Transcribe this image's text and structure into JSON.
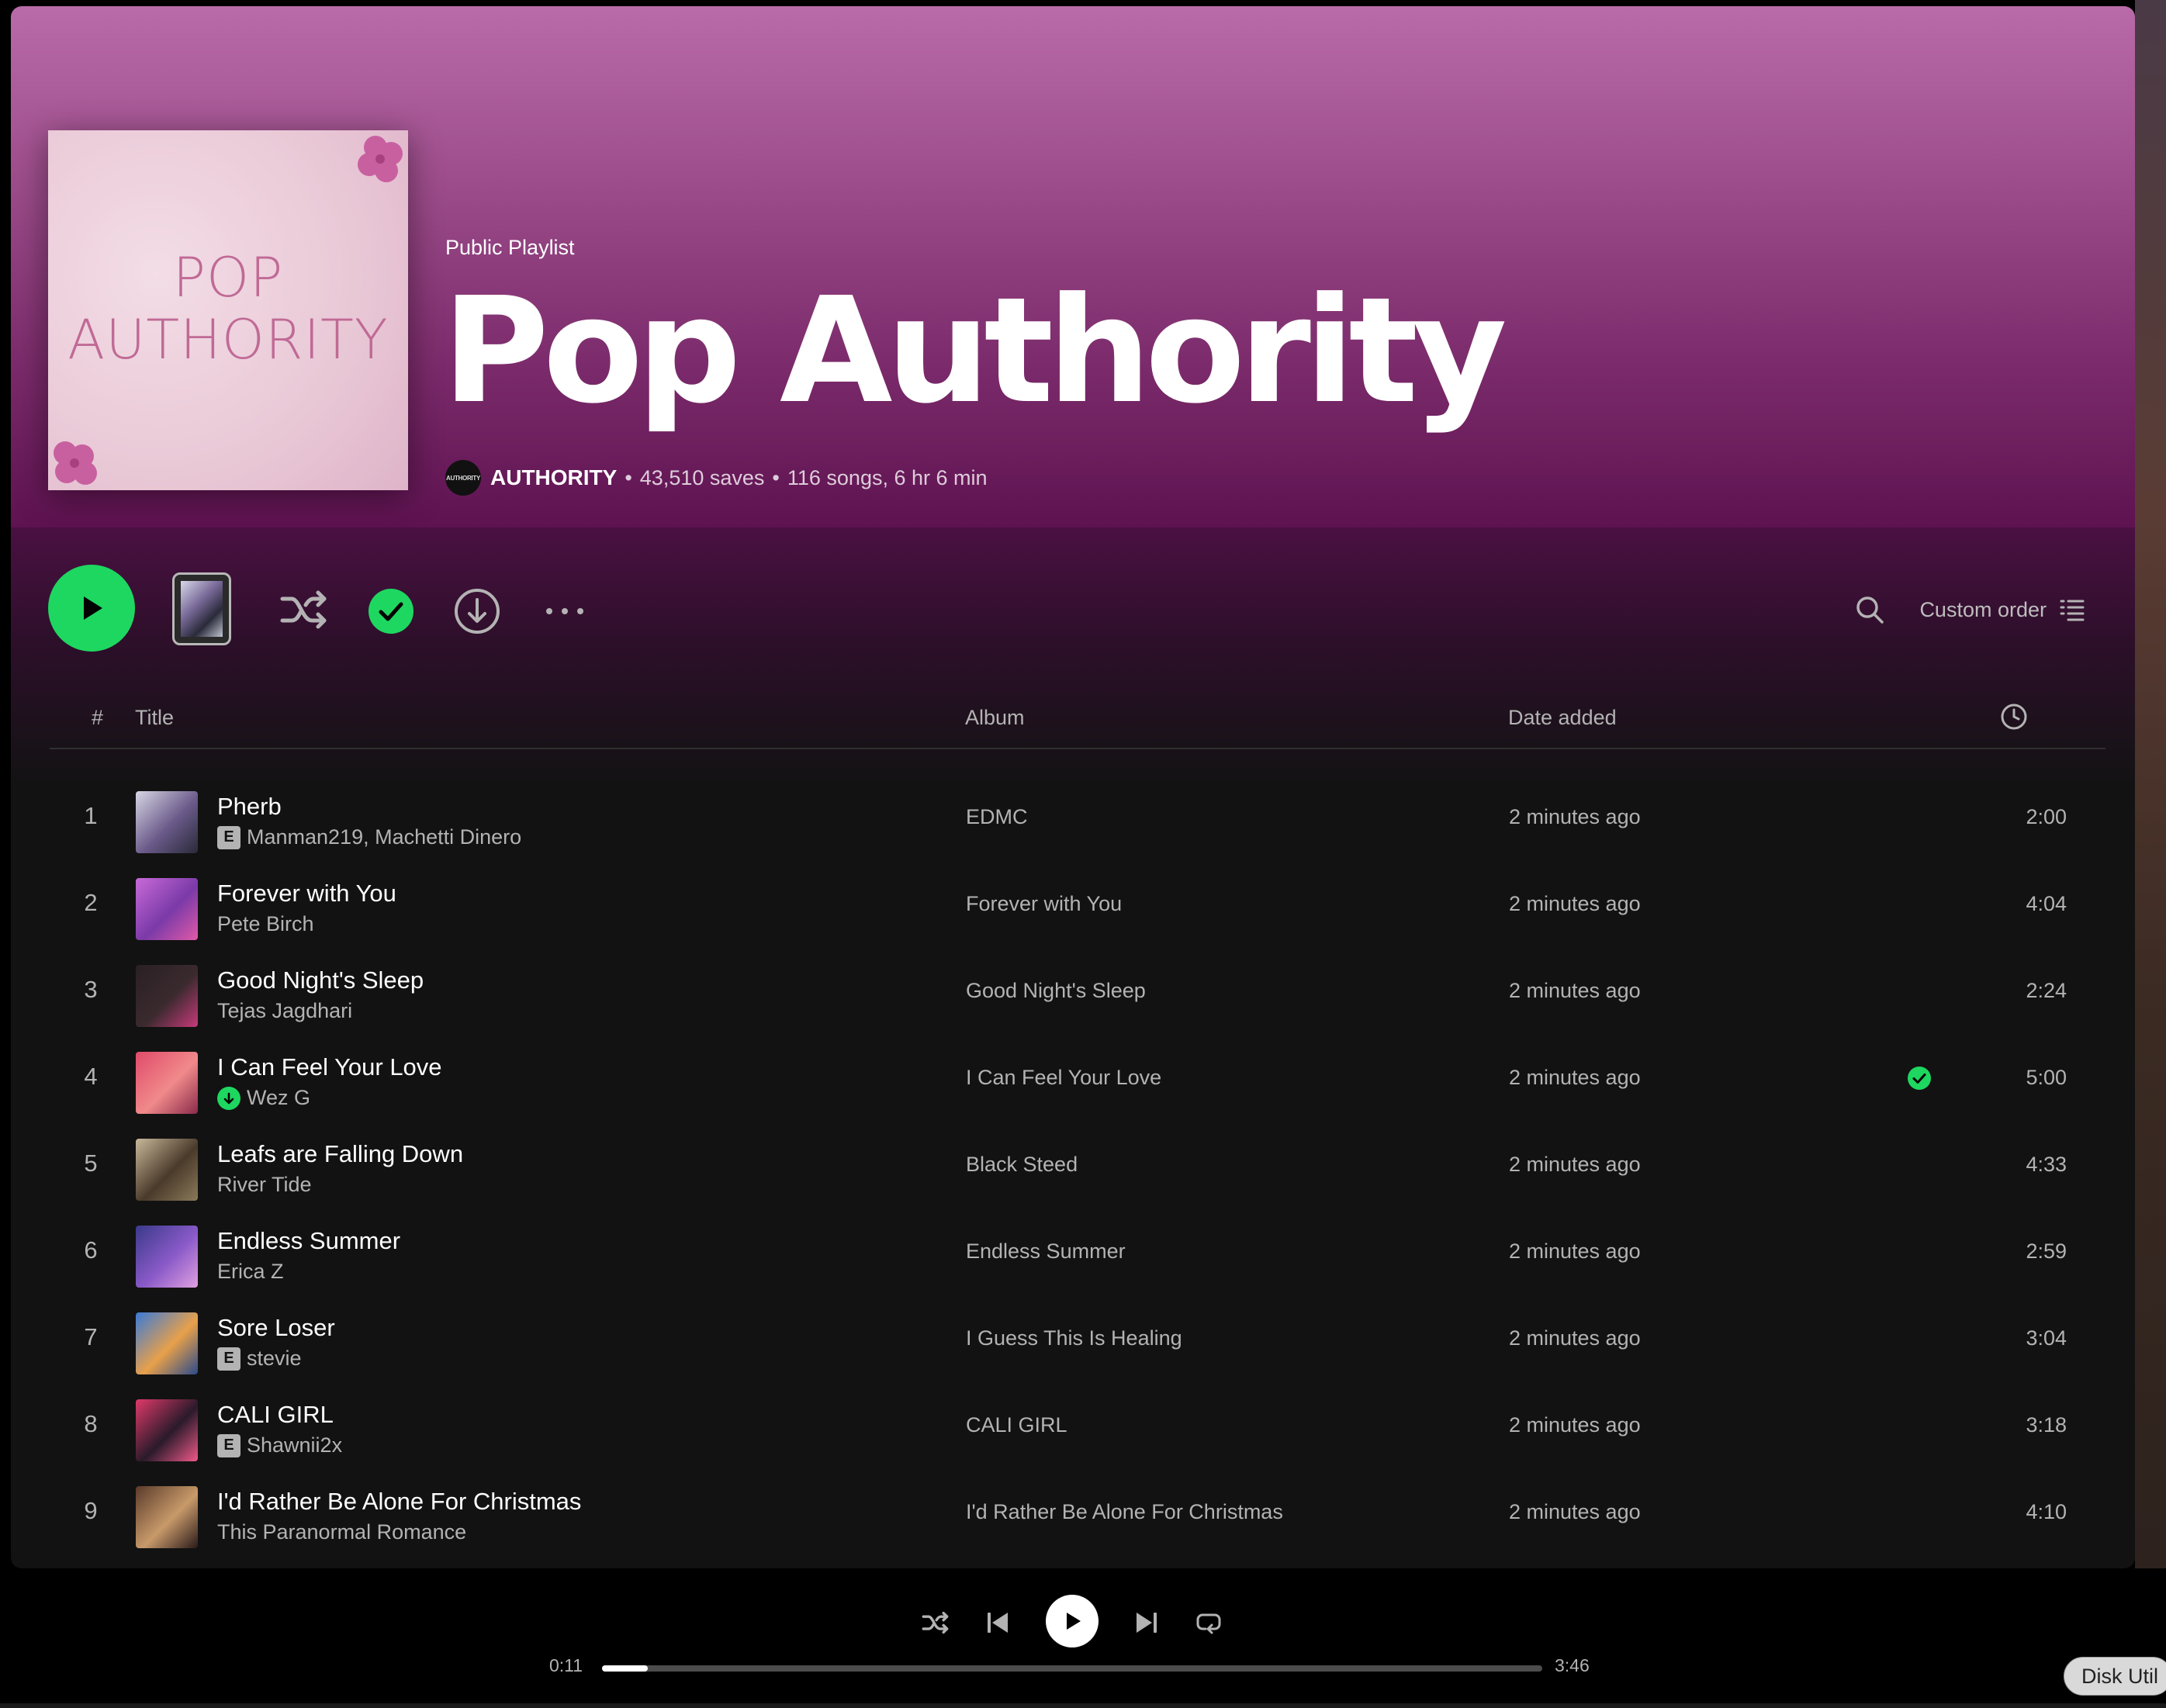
{
  "playlist": {
    "type_label": "Public Playlist",
    "title": "Pop Authority",
    "cover_text": "POP\nAUTHORITY",
    "owner_avatar_text": "AUTHORITY",
    "owner": "AUTHORITY",
    "saves": "43,510 saves",
    "summary": "116 songs, 6 hr 6 min",
    "separator": "•"
  },
  "actions": {
    "sort_label": "Custom order"
  },
  "table": {
    "col_num": "#",
    "col_title": "Title",
    "col_album": "Album",
    "col_date": "Date added",
    "duration_icon": "clock-icon"
  },
  "tracks": [
    {
      "num": "1",
      "title": "Pherb",
      "artist": "Manman219, Machetti Dinero",
      "explicit": true,
      "downloaded": false,
      "album": "EDMC",
      "date": "2 minutes ago",
      "saved": false,
      "duration": "2:00",
      "art": [
        "#d8d6e4",
        "#6a5a8a",
        "#2a2a38"
      ]
    },
    {
      "num": "2",
      "title": "Forever with You",
      "artist": "Pete Birch",
      "explicit": false,
      "downloaded": false,
      "album": "Forever with You",
      "date": "2 minutes ago",
      "saved": false,
      "duration": "4:04",
      "art": [
        "#c86ad8",
        "#7a3aa8",
        "#e05aa8"
      ]
    },
    {
      "num": "3",
      "title": "Good Night's Sleep",
      "artist": "Tejas Jagdhari",
      "explicit": false,
      "downloaded": false,
      "album": "Good Night's Sleep",
      "date": "2 minutes ago",
      "saved": false,
      "duration": "2:24",
      "art": [
        "#2a2024",
        "#3a2a2e",
        "#c83a7a"
      ]
    },
    {
      "num": "4",
      "title": "I Can Feel Your Love",
      "artist": "Wez G",
      "explicit": false,
      "downloaded": true,
      "album": "I Can Feel Your Love",
      "date": "2 minutes ago",
      "saved": true,
      "duration": "5:00",
      "art": [
        "#e04a6a",
        "#f08a8a",
        "#8a2a4a"
      ]
    },
    {
      "num": "5",
      "title": "Leafs are Falling Down",
      "artist": "River Tide",
      "explicit": false,
      "downloaded": false,
      "album": "Black Steed",
      "date": "2 minutes ago",
      "saved": false,
      "duration": "4:33",
      "art": [
        "#c8b89a",
        "#4a3a2a",
        "#8a7a5a"
      ]
    },
    {
      "num": "6",
      "title": "Endless Summer",
      "artist": "Erica Z",
      "explicit": false,
      "downloaded": false,
      "album": "Endless Summer",
      "date": "2 minutes ago",
      "saved": false,
      "duration": "2:59",
      "art": [
        "#3a3a8a",
        "#8a5ac8",
        "#e0a0e0"
      ]
    },
    {
      "num": "7",
      "title": "Sore Loser",
      "artist": "stevie",
      "explicit": true,
      "downloaded": false,
      "album": "I Guess This Is Healing",
      "date": "2 minutes ago",
      "saved": false,
      "duration": "3:04",
      "art": [
        "#3a7ad8",
        "#e8a04a",
        "#2a4a8a"
      ]
    },
    {
      "num": "8",
      "title": "CALI GIRL",
      "artist": "Shawnii2x",
      "explicit": true,
      "downloaded": false,
      "album": "CALI GIRL",
      "date": "2 minutes ago",
      "saved": false,
      "duration": "3:18",
      "art": [
        "#e03a6a",
        "#2a1a2a",
        "#f05a8a"
      ]
    },
    {
      "num": "9",
      "title": "I'd Rather Be Alone For Christmas",
      "artist": "This Paranormal Romance",
      "explicit": false,
      "downloaded": false,
      "album": "I'd Rather Be Alone For Christmas",
      "date": "2 minutes ago",
      "saved": false,
      "duration": "4:10",
      "art": [
        "#5a3a2a",
        "#c89a6a",
        "#2a1a1a"
      ]
    }
  ],
  "player": {
    "elapsed": "0:11",
    "total": "3:46",
    "progress_fraction": 0.049
  },
  "dock_tooltip": "Disk Util",
  "colors": {
    "accent": "#1ed760",
    "hero_top": "#b96aa8",
    "hero_bottom": "#5e1250"
  }
}
